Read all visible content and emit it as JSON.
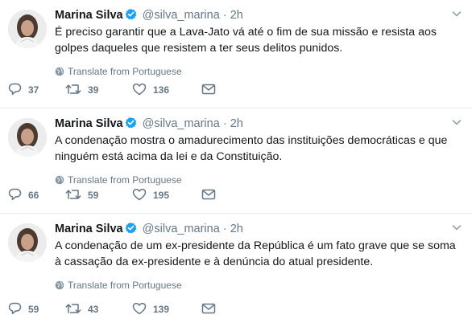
{
  "tweets": [
    {
      "name": "Marina Silva",
      "handle": "@silva_marina",
      "separator": "·",
      "time": "2h",
      "text": "É preciso garantir que a Lava-Jato vá até o fim de sua missão e resista aos golpes daqueles que resistem a ter seus delitos punidos.",
      "translate": "Translate from Portuguese",
      "replies": "37",
      "retweets": "39",
      "likes": "136"
    },
    {
      "name": "Marina Silva",
      "handle": "@silva_marina",
      "separator": "·",
      "time": "2h",
      "text": "A condenação mostra o amadurecimento das instituições democráticas e que ninguém está acima da lei e da Constituição.",
      "translate": "Translate from Portuguese",
      "replies": "66",
      "retweets": "59",
      "likes": "195"
    },
    {
      "name": "Marina Silva",
      "handle": "@silva_marina",
      "separator": "·",
      "time": "2h",
      "text": "A condenação de um ex-presidente da República é um fato grave que se soma à cassação da ex-presidente e à denúncia do atual presidente.",
      "translate": "Translate from Portuguese",
      "replies": "59",
      "retweets": "43",
      "likes": "139"
    }
  ],
  "icons": {
    "verified": "verified-badge-icon",
    "caret": "chevron-down-icon",
    "globe": "globe-icon",
    "reply": "reply-icon",
    "retweet": "retweet-icon",
    "like": "heart-icon",
    "message": "envelope-icon"
  },
  "colors": {
    "text": "#14171a",
    "secondary": "#657786",
    "verified": "#1da1f2",
    "divider": "#e6ecf0"
  }
}
